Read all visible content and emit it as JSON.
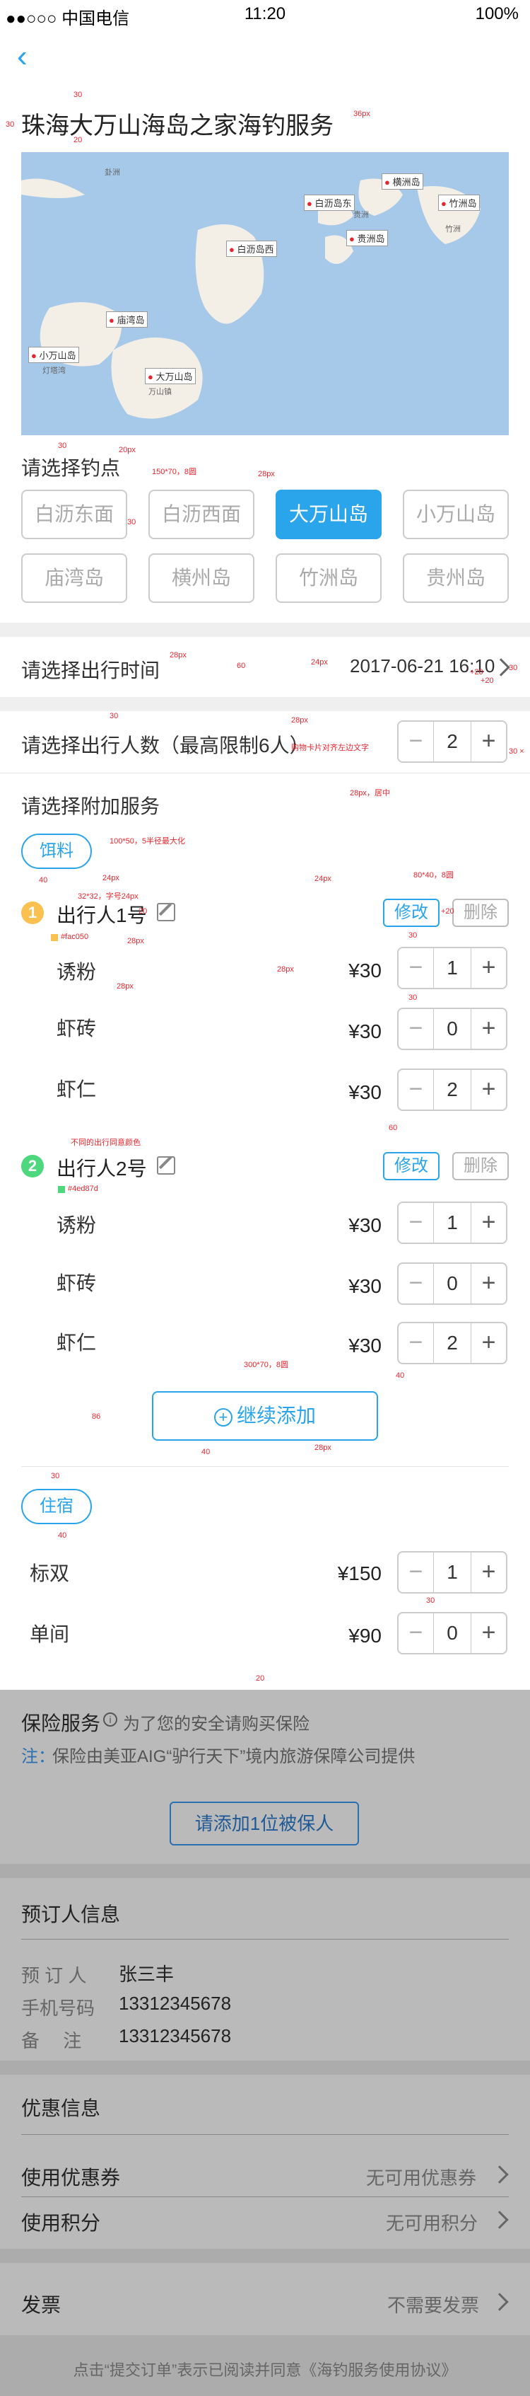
{
  "status": {
    "carrier": "●●○○○ 中国电信",
    "time": "11:20",
    "battery": "100%"
  },
  "header": {
    "back_icon": "chevron-left-icon",
    "title": "珠海大万山海岛之家海钓服务"
  },
  "map": {
    "pins": [
      "横洲岛",
      "白沥岛东",
      "竹洲岛",
      "贵洲岛",
      "白沥岛西",
      "庙湾岛",
      "小万山岛",
      "大万山岛"
    ],
    "labels": [
      "卦洲",
      "竹洲",
      "贵洲",
      "万山镇",
      "灯塔湾"
    ]
  },
  "spots": {
    "label": "请选择钓点",
    "options": [
      "白沥东面",
      "白沥西面",
      "大万山岛",
      "小万山岛",
      "庙湾岛",
      "横州岛",
      "竹洲岛",
      "贵州岛"
    ],
    "selected": "大万山岛"
  },
  "time": {
    "label": "请选择出行时间",
    "value": "2017-06-21 16:10"
  },
  "people": {
    "label": "请选择出行人数（最高限制6人）",
    "count": "2"
  },
  "extra": {
    "label": "请选择附加服务",
    "bait_label": "饵料",
    "lodging_label": "住宿"
  },
  "travelers": [
    {
      "index": "1",
      "name": "出行人1号",
      "color": "#fac050",
      "edit": "修改",
      "del": "删除",
      "items": [
        {
          "name": "诱粉",
          "price": "¥30",
          "qty": "1"
        },
        {
          "name": "虾砖",
          "price": "¥30",
          "qty": "0"
        },
        {
          "name": "虾仁",
          "price": "¥30",
          "qty": "2"
        }
      ]
    },
    {
      "index": "2",
      "name": "出行人2号",
      "color": "#4ed87d",
      "edit": "修改",
      "del": "删除",
      "items": [
        {
          "name": "诱粉",
          "price": "¥30",
          "qty": "1"
        },
        {
          "name": "虾砖",
          "price": "¥30",
          "qty": "0"
        },
        {
          "name": "虾仁",
          "price": "¥30",
          "qty": "2"
        }
      ]
    }
  ],
  "continue_add": "继续添加",
  "rooms": [
    {
      "name": "标双",
      "price": "¥150",
      "qty": "1"
    },
    {
      "name": "单间",
      "price": "¥90",
      "qty": "0"
    }
  ],
  "insurance": {
    "title": "保险服务",
    "hint": "为了您的安全请购买保险",
    "note_prefix": "注：",
    "note": "保险由美亚AIG“驴行天下”境内旅游保障公司提供",
    "button": "请添加1位被保人"
  },
  "booker": {
    "title": "预订人信息",
    "name_label": "预 订 人",
    "name": "张三丰",
    "phone_label": "手机号码",
    "phone": "13312345678",
    "remark_label": "备　 注",
    "remark": "13312345678"
  },
  "discount": {
    "title": "优惠信息",
    "coupon_label": "使用优惠券",
    "coupon_value": "无可用优惠券",
    "points_label": "使用积分",
    "points_value": "无可用积分"
  },
  "invoice": {
    "label": "发票",
    "value": "不需要发票"
  },
  "agreement": "点击“提交订单”表示已阅读并同意《海钓服务使用协议》",
  "annotations": {
    "a1": "30",
    "a2": "20",
    "a3": "36px",
    "a4": "30",
    "a5": "30",
    "a6": "20px",
    "a7": "150*70，8圆",
    "a8": "28px",
    "a9": "30",
    "a10": "28px",
    "a11": "60",
    "a12": "24px",
    "a13": "+20",
    "a14": "30",
    "a15": "+20",
    "a16": "28px",
    "a17": "购物卡片对齐左边文字",
    "a18": "30",
    "a19": "28px，居中",
    "a20": "100*50，5半径最大化",
    "a21": "24px",
    "a22": "32*32，字号24px",
    "a23": "28px",
    "a24": "#fac050",
    "a25": "24px",
    "a26": "80*40，8圆",
    "a27": "+20",
    "a28": "30",
    "a29": "28px",
    "a30": "30",
    "a31": "不同的出行同意颜色",
    "a32": "#4ed87d",
    "a33": "60",
    "a34": "40",
    "a35": "300*70，8圆",
    "a36": "86",
    "a37": "40",
    "a38": "28px",
    "a39": "30",
    "a40": "40",
    "a41": "30",
    "a42": "20",
    "a43": "20",
    "a44": "+20",
    "a45": "30",
    "a46": "30 ×"
  }
}
